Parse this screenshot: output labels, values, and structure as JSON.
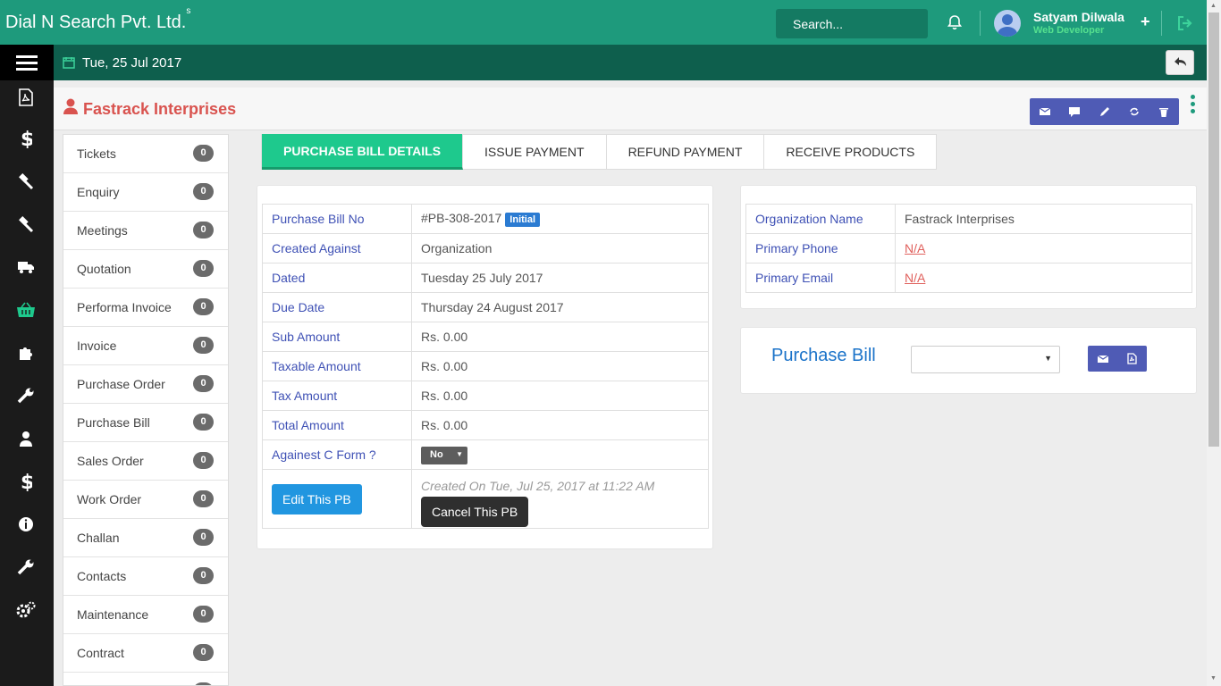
{
  "app": {
    "brand": "Dial N Search Pvt. Ltd.",
    "brand_sup": "s",
    "search_placeholder": "Search...",
    "user_name": "Satyam Dilwala",
    "user_role": "Web Developer",
    "plus": "+"
  },
  "subbar": {
    "date": "Tue, 25 Jul 2017"
  },
  "page": {
    "title": "Fastrack Interprises"
  },
  "sidebar": {
    "items": [
      {
        "label": "Tickets",
        "count": "0"
      },
      {
        "label": "Enquiry",
        "count": "0"
      },
      {
        "label": "Meetings",
        "count": "0"
      },
      {
        "label": "Quotation",
        "count": "0"
      },
      {
        "label": "Performa Invoice",
        "count": "0"
      },
      {
        "label": "Invoice",
        "count": "0"
      },
      {
        "label": "Purchase Order",
        "count": "0"
      },
      {
        "label": "Purchase Bill",
        "count": "0"
      },
      {
        "label": "Sales Order",
        "count": "0"
      },
      {
        "label": "Work Order",
        "count": "0"
      },
      {
        "label": "Challan",
        "count": "0"
      },
      {
        "label": "Contacts",
        "count": "0"
      },
      {
        "label": "Maintenance",
        "count": "0"
      },
      {
        "label": "Contract",
        "count": "0"
      }
    ]
  },
  "tabs": [
    "PURCHASE BILL DETAILS",
    "ISSUE PAYMENT",
    "REFUND PAYMENT",
    "RECEIVE PRODUCTS"
  ],
  "bill": {
    "bill_no_label": "Purchase Bill No",
    "bill_no": "#PB-308-2017",
    "status": "Initial",
    "created_against_label": "Created Against",
    "created_against": "Organization",
    "dated_label": "Dated",
    "dated": "Tuesday 25 July 2017",
    "due_label": "Due Date",
    "due": "Thursday 24 August 2017",
    "sub_label": "Sub Amount",
    "sub": "Rs. 0.00",
    "taxable_label": "Taxable Amount",
    "taxable": "Rs. 0.00",
    "tax_label": "Tax Amount",
    "tax": "Rs. 0.00",
    "total_label": "Total Amount",
    "total": "Rs. 0.00",
    "cform_label": "Againest C Form ?",
    "cform": "No",
    "edit_label": "Edit This PB",
    "created_on": "Created On Tue, Jul 25, 2017 at 11:22 AM",
    "cancel_label": "Cancel This PB"
  },
  "org": {
    "name_label": "Organization Name",
    "name": "Fastrack Interprises",
    "phone_label": "Primary Phone",
    "phone": "N/A",
    "email_label": "Primary Email",
    "email": "N/A"
  },
  "pb_card": {
    "label": "Purchase Bill",
    "select_value": ""
  },
  "colors": {
    "topbar": "#1e9a7c",
    "subbar": "#0e5f4d",
    "accent_tab": "#1ec98d",
    "action_blue": "#4f5bb5",
    "title_red": "#d9534f"
  }
}
